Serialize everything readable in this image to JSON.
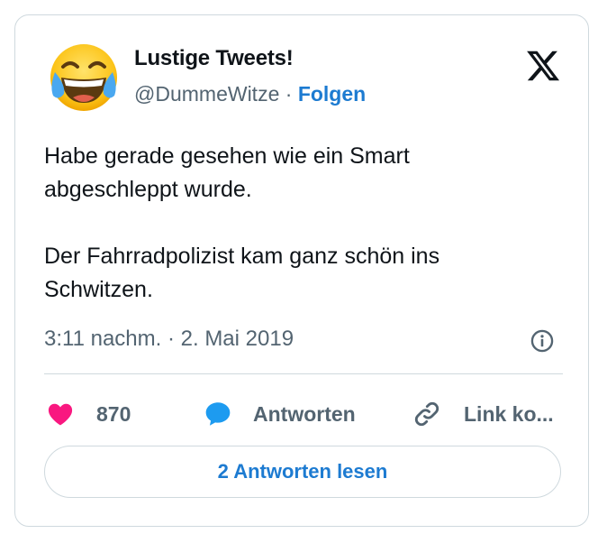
{
  "tweet": {
    "display_name": "Lustige Tweets!",
    "handle": "@DummeWitze",
    "separator": " · ",
    "follow_label": "Folgen",
    "text": "Habe gerade gesehen wie ein Smart\nabgeschleppt wurde.\n\nDer Fahrradpolizist kam ganz schön ins\nSchwitzen.",
    "timestamp": "3:11 nachm. · 2. Mai 2019"
  },
  "actions": {
    "likes_count": "870",
    "reply_label": "Antworten",
    "copy_link_label": "Link ko..."
  },
  "read_replies_label": "2 Antworten lesen",
  "icons": {
    "avatar": "face-with-tears-of-joy-emoji",
    "logo": "x-logo-icon",
    "info": "info-icon",
    "like": "heart-icon",
    "reply": "speech-bubble-icon",
    "link": "link-icon"
  },
  "colors": {
    "accent": "#1d7bd1",
    "like": "#f91880",
    "reply": "#1d9bf0",
    "muted": "#536471",
    "border": "#cfd9de"
  }
}
